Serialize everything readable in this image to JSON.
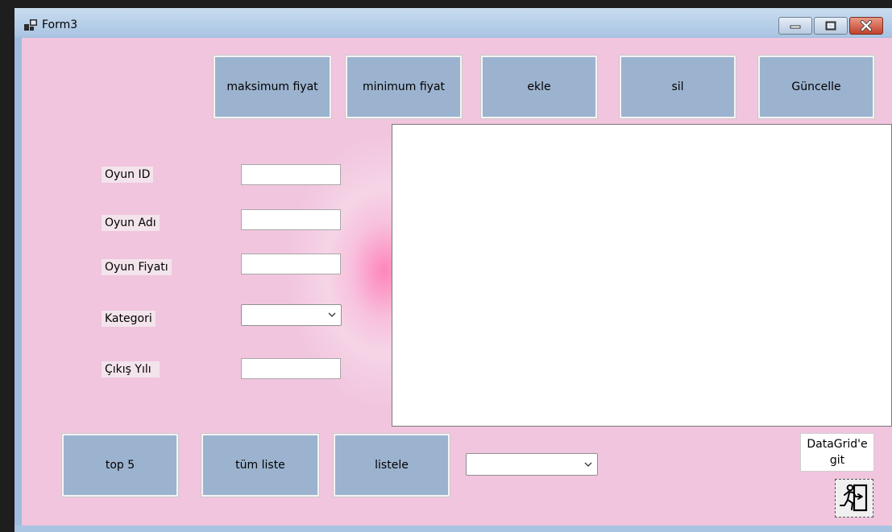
{
  "window": {
    "title": "Form3"
  },
  "toolbar": {
    "max_price_label": "maksimum fiyat",
    "min_price_label": "minimum fiyat",
    "add_label": "ekle",
    "delete_label": "sil",
    "update_label": "Güncelle"
  },
  "form": {
    "game_id_label": "Oyun ID",
    "game_name_label": "Oyun Adı",
    "game_price_label": "Oyun Fiyatı",
    "category_label": "Kategori",
    "release_year_label": "Çıkış Yılı",
    "game_id_value": "",
    "game_name_value": "",
    "game_price_value": "",
    "category_value": "",
    "release_year_value": ""
  },
  "bottom": {
    "top5_label": "top 5",
    "all_list_label": "tüm liste",
    "list_label": "listele",
    "filter_value": "",
    "datagrid_button_line1": "DataGrid'e",
    "datagrid_button_line2": "git"
  },
  "icons": {
    "app": "app-icon",
    "minimize": "minimize-icon",
    "maximize": "maximize-icon",
    "close": "close-icon",
    "exit": "exit-running-person-icon",
    "dropdown": "chevron-down-icon"
  },
  "colors": {
    "form_background": "#f1c5de",
    "button_background": "#9cb3cf",
    "close_button": "#c2412a"
  }
}
